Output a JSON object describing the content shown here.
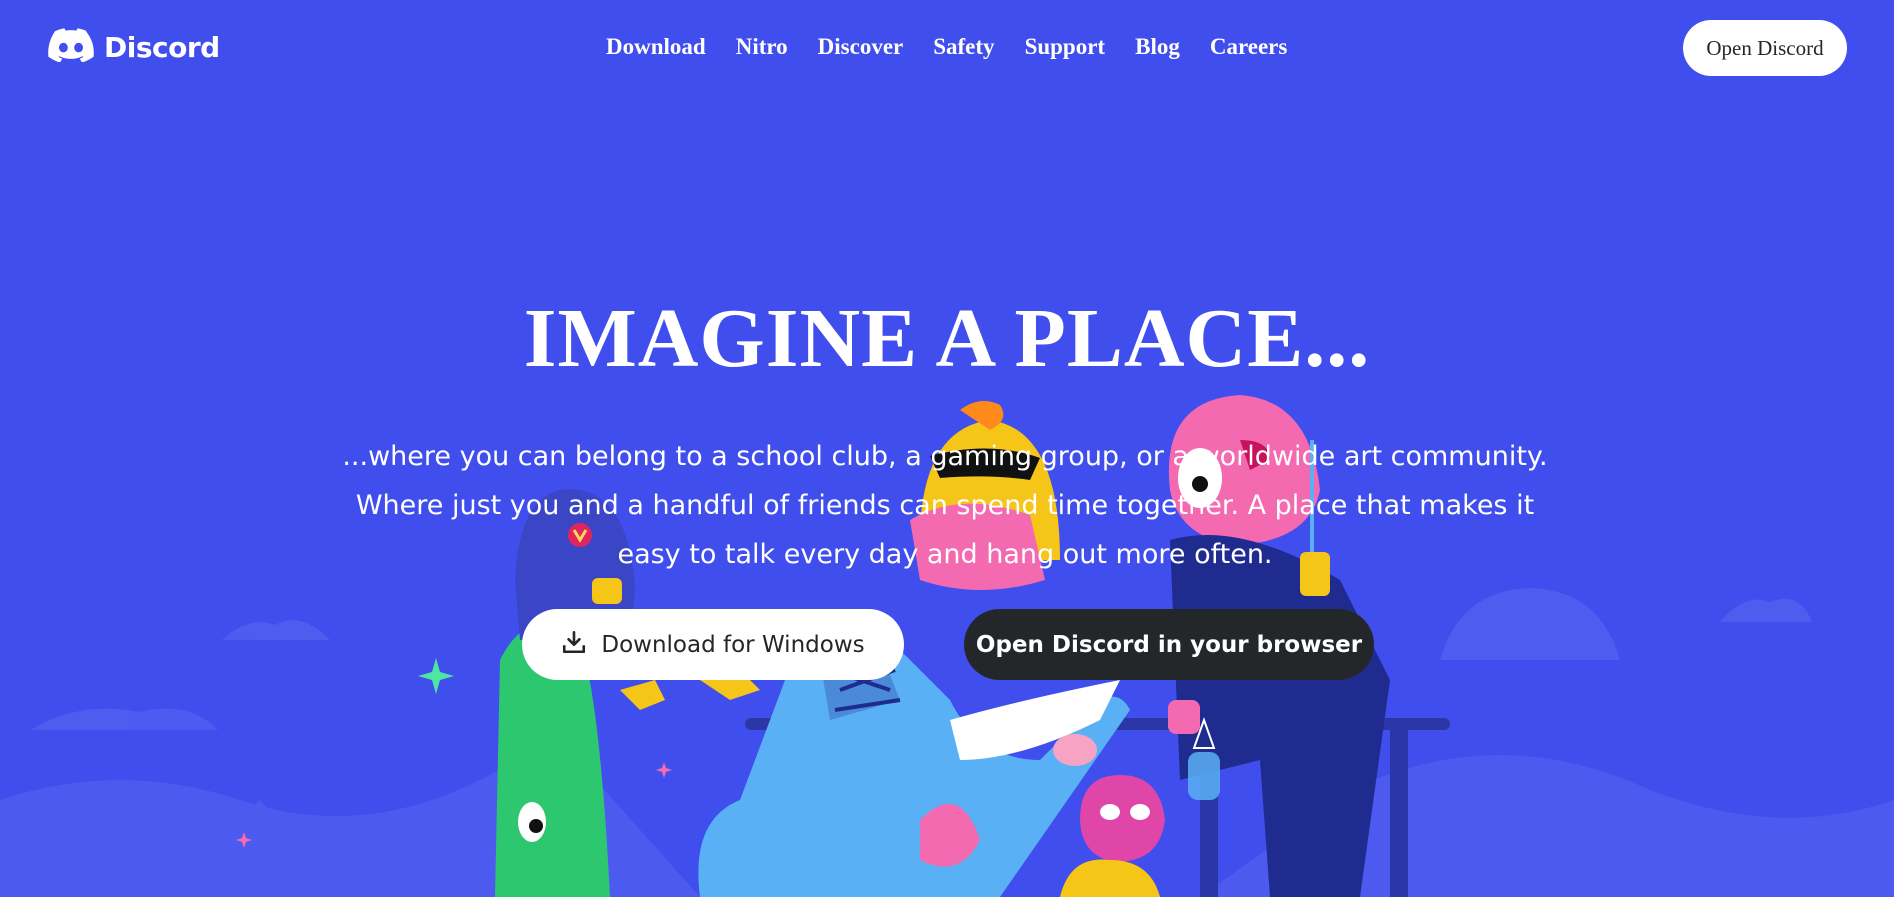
{
  "brand": {
    "name": "Discord",
    "logo_icon": "discord-logo-icon",
    "background_color": "#404eed"
  },
  "nav": {
    "items": [
      {
        "label": "Download"
      },
      {
        "label": "Nitro"
      },
      {
        "label": "Discover"
      },
      {
        "label": "Safety"
      },
      {
        "label": "Support"
      },
      {
        "label": "Blog"
      },
      {
        "label": "Careers"
      }
    ],
    "cta_label": "Open Discord"
  },
  "hero": {
    "title": "IMAGINE A PLACE...",
    "description": "...where you can belong to a school club, a gaming group, or a worldwide art community. Where just you and a handful of friends can spend time together. A place that makes it easy to talk every day and hang out more often.",
    "download_button_label": "Download for Windows",
    "download_icon": "download-icon",
    "browser_button_label": "Open Discord in your browser",
    "dark_button_color": "#23272a"
  }
}
